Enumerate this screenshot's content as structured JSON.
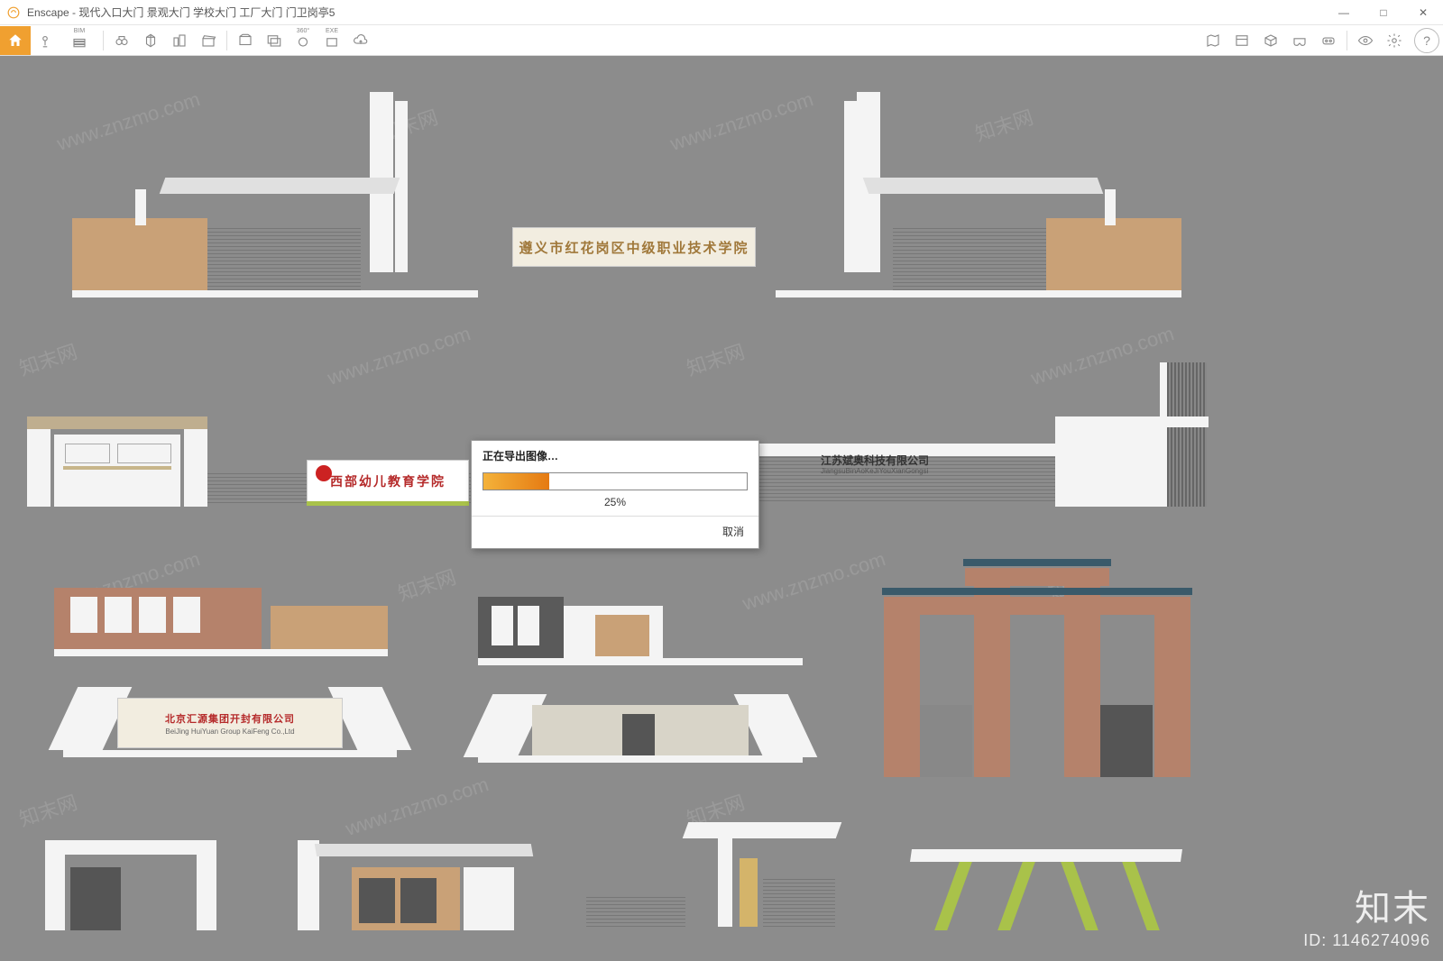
{
  "window": {
    "app_name": "Enscape",
    "title_suffix": "现代入口大门 景观大门 学校大门 工厂大门 门卫岗亭5",
    "controls": {
      "minimize": "—",
      "maximize": "□",
      "close": "✕"
    }
  },
  "toolbar": {
    "bim_label": "BIM",
    "pano_label": "360°",
    "exe_label": "EXE"
  },
  "dialog": {
    "title": "正在导出图像…",
    "progress_percent": "25%",
    "progress_value": 25,
    "cancel_label": "取消"
  },
  "scene_signs": {
    "top_center": "遵义市红花岗区中级职业技术学院",
    "mid_left": "西部幼儿教育学院",
    "mid_right_line1": "江苏斌奥科技有限公司",
    "mid_right_line2": "JiangsuBinAoKeJiYouXianGongsi",
    "bottom_left_cn": "北京汇源集团开封有限公司",
    "bottom_left_en": "BeiJing HuiYuan Group KaiFeng Co.,Ltd"
  },
  "watermark": {
    "brand": "知末",
    "id_line": "ID: 1146274096",
    "site": "www.znzmo.com",
    "cn": "知末网"
  },
  "collapse_glyph": "▴",
  "colors": {
    "accent": "#f0a030",
    "viewport_bg": "#8c8c8c"
  }
}
